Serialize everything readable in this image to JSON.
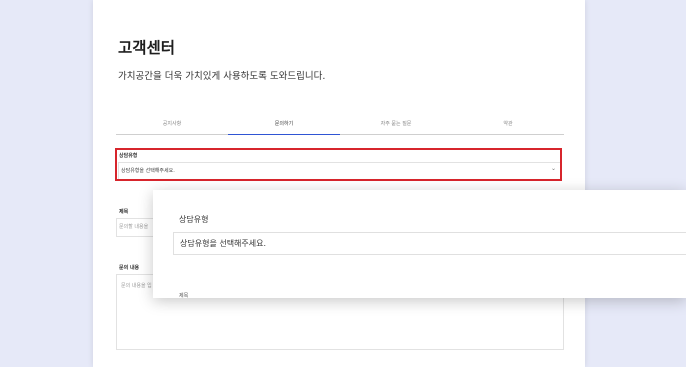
{
  "page": {
    "title": "고객센터",
    "subtitle": "가치공간을 더욱 가치있게 사용하도록 도와드립니다."
  },
  "tabs": [
    {
      "label": "공지사항"
    },
    {
      "label": "문의하기"
    },
    {
      "label": "자주 묻는 질문"
    },
    {
      "label": "약관"
    }
  ],
  "form": {
    "type_label": "상담유형",
    "type_placeholder": "상담유형을 선택해주세요.",
    "subject_label": "제목",
    "subject_placeholder": "문의할 내용을 ",
    "content_label": "문의 내용",
    "content_placeholder": "문의 내용을 입"
  },
  "zoom_popup": {
    "label": "상담유형",
    "placeholder": "상담유형을 선택해주세요.",
    "cut_label": "제목"
  },
  "colors": {
    "background_side": "#e6e9f8",
    "highlight": "#d7252c",
    "active_tab": "#2f55d4"
  }
}
